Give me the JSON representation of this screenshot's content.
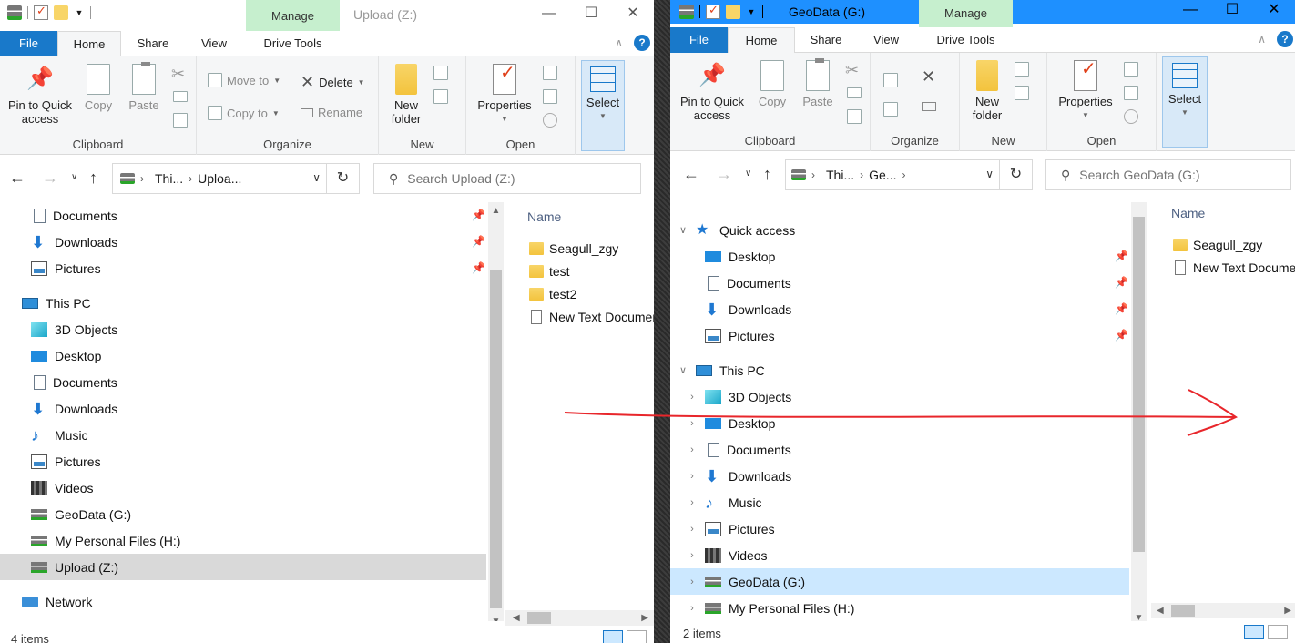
{
  "left": {
    "window_title": "Upload (Z:)",
    "manage_label": "Manage",
    "tabs": [
      "File",
      "Home",
      "Share",
      "View",
      "Drive Tools"
    ],
    "ribbon": {
      "clipboard": {
        "pin_label": "Pin to Quick access",
        "copy_label": "Copy",
        "paste_label": "Paste",
        "group_label": "Clipboard"
      },
      "organize": {
        "move_to_label": "Move to",
        "copy_to_label": "Copy to",
        "delete_label": "Delete",
        "rename_label": "Rename",
        "group_label": "Organize"
      },
      "new": {
        "new_folder_label": "New folder",
        "group_label": "New"
      },
      "open": {
        "properties_label": "Properties",
        "group_label": "Open"
      },
      "select": {
        "select_label": "Select"
      }
    },
    "address": {
      "seg1": "Thi...",
      "seg2": "Uploa..."
    },
    "search_placeholder": "Search Upload (Z:)",
    "nav_items": [
      {
        "label": "Documents",
        "icon": "documents-icon"
      },
      {
        "label": "Downloads",
        "icon": "downloads-icon"
      },
      {
        "label": "Pictures",
        "icon": "pictures-icon"
      },
      {
        "label": "This PC",
        "icon": "this-pc-icon"
      },
      {
        "label": "3D Objects",
        "icon": "3d-objects-icon"
      },
      {
        "label": "Desktop",
        "icon": "desktop-icon"
      },
      {
        "label": "Documents",
        "icon": "documents-icon"
      },
      {
        "label": "Downloads",
        "icon": "downloads-icon"
      },
      {
        "label": "Music",
        "icon": "music-icon"
      },
      {
        "label": "Pictures",
        "icon": "pictures-icon"
      },
      {
        "label": "Videos",
        "icon": "videos-icon"
      },
      {
        "label": "GeoData (G:)",
        "icon": "drive-icon"
      },
      {
        "label": "My Personal Files (H:)",
        "icon": "drive-icon"
      },
      {
        "label": "Upload (Z:)",
        "icon": "drive-icon",
        "selected": true
      },
      {
        "label": "Network",
        "icon": "network-icon"
      }
    ],
    "column_name": "Name",
    "files": [
      {
        "name": "Seagull_zgy",
        "type": "folder"
      },
      {
        "name": "test",
        "type": "folder"
      },
      {
        "name": "test2",
        "type": "folder"
      },
      {
        "name": "New Text Document.txt",
        "type": "text"
      }
    ],
    "status": "4 items"
  },
  "right": {
    "window_title": "GeoData (G:)",
    "manage_label": "Manage",
    "tabs": [
      "File",
      "Home",
      "Share",
      "View",
      "Drive Tools"
    ],
    "ribbon": {
      "clipboard": {
        "pin_label": "Pin to Quick access",
        "copy_label": "Copy",
        "paste_label": "Paste",
        "group_label": "Clipboard"
      },
      "organize": {
        "group_label": "Organize"
      },
      "new": {
        "new_folder_label": "New folder",
        "group_label": "New"
      },
      "open": {
        "properties_label": "Properties",
        "group_label": "Open"
      },
      "select": {
        "select_label": "Select"
      }
    },
    "address": {
      "seg1": "Thi...",
      "seg2": "Ge..."
    },
    "search_placeholder": "Search GeoData (G:)",
    "nav_items": [
      {
        "label": "Quick access",
        "icon": "quick-access-star-icon"
      },
      {
        "label": "Desktop",
        "icon": "desktop-icon"
      },
      {
        "label": "Documents",
        "icon": "documents-icon"
      },
      {
        "label": "Downloads",
        "icon": "downloads-icon"
      },
      {
        "label": "Pictures",
        "icon": "pictures-icon"
      },
      {
        "label": "This PC",
        "icon": "this-pc-icon"
      },
      {
        "label": "3D Objects",
        "icon": "3d-objects-icon"
      },
      {
        "label": "Desktop",
        "icon": "desktop-icon"
      },
      {
        "label": "Documents",
        "icon": "documents-icon"
      },
      {
        "label": "Downloads",
        "icon": "downloads-icon"
      },
      {
        "label": "Music",
        "icon": "music-icon"
      },
      {
        "label": "Pictures",
        "icon": "pictures-icon"
      },
      {
        "label": "Videos",
        "icon": "videos-icon"
      },
      {
        "label": "GeoData (G:)",
        "icon": "drive-icon",
        "selected": true
      },
      {
        "label": "My Personal Files (H:)",
        "icon": "drive-icon"
      }
    ],
    "column_name": "Name",
    "files": [
      {
        "name": "Seagull_zgy",
        "type": "folder"
      },
      {
        "name": "New Text Document.txt",
        "type": "text"
      }
    ],
    "status": "2 items"
  },
  "colors": {
    "file_tab": "#1979ca",
    "manage_tab": "#c6efce",
    "right_titlebar": "#1e90ff",
    "selection": "#cce8ff",
    "annotation_arrow": "#e8262b"
  }
}
